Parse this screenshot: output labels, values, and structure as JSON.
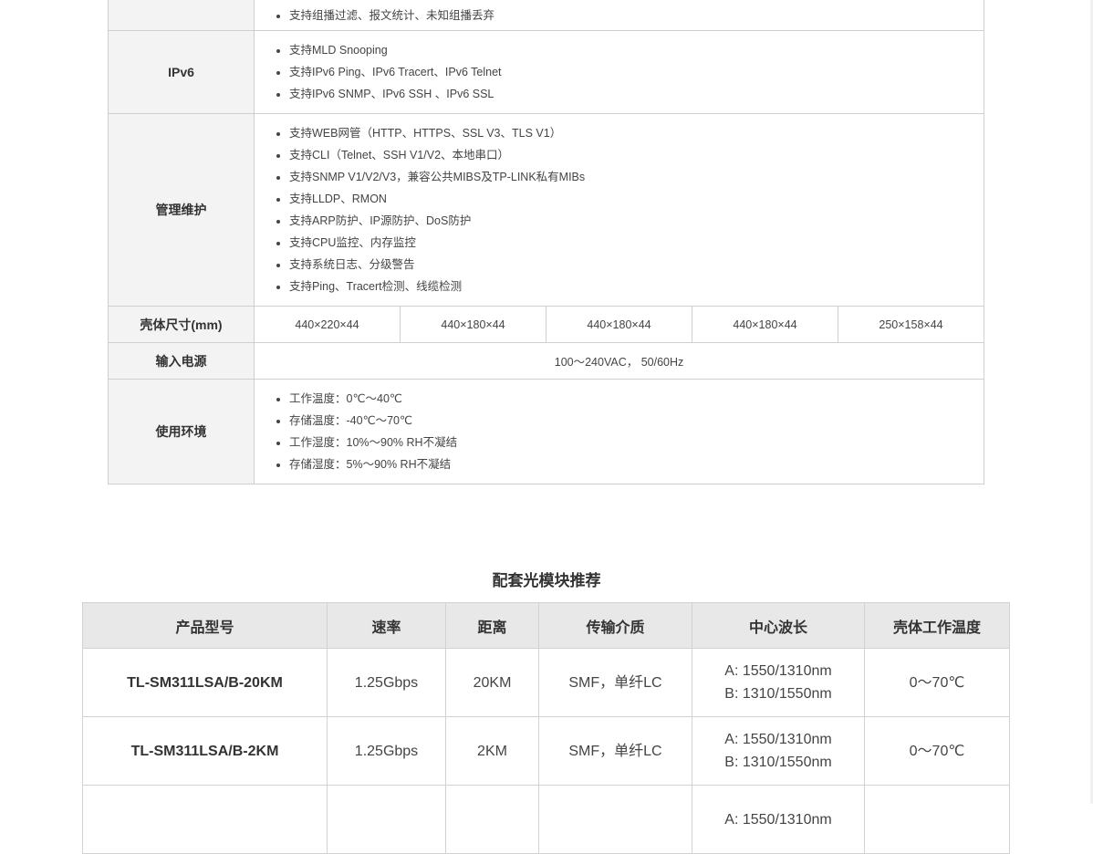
{
  "spec": {
    "multicast": {
      "items": [
        "支持组播过滤、报文统计、未知组播丢弃"
      ]
    },
    "ipv6": {
      "label": "IPv6",
      "items": [
        "支持MLD Snooping",
        "支持IPv6 Ping、IPv6 Tracert、IPv6 Telnet",
        "支持IPv6 SNMP、IPv6 SSH 、IPv6 SSL"
      ]
    },
    "management": {
      "label": "管理维护",
      "items": [
        "支持WEB网管（HTTP、HTTPS、SSL V3、TLS V1）",
        "支持CLI（Telnet、SSH V1/V2、本地串口）",
        "支持SNMP V1/V2/V3，兼容公共MIBS及TP-LINK私有MIBs",
        "支持LLDP、RMON",
        "支持ARP防护、IP源防护、DoS防护",
        "支持CPU监控、内存监控",
        "支持系统日志、分级警告",
        "支持Ping、Tracert检测、线缆检测"
      ]
    },
    "dimensions": {
      "label": "壳体尺寸(mm)",
      "values": [
        "440×220×44",
        "440×180×44",
        "440×180×44",
        "440×180×44",
        "250×158×44"
      ]
    },
    "power": {
      "label": "输入电源",
      "value": "100～240VAC， 50/60Hz"
    },
    "environment": {
      "label": "使用环境",
      "items": [
        "工作温度：0℃～40℃",
        "存储温度：-40℃～70℃",
        "工作湿度：10%～90% RH不凝结",
        "存储湿度：5%～90% RH不凝结"
      ]
    }
  },
  "optical": {
    "title": "配套光模块推荐",
    "headers": [
      "产品型号",
      "速率",
      "距离",
      "传输介质",
      "中心波长",
      "壳体工作温度"
    ],
    "rows": [
      {
        "model": "TL-SM311LSA/B-20KM",
        "rate": "1.25Gbps",
        "distance": "20KM",
        "medium": "SMF，单纤LC",
        "wl_a": "A: 1550/1310nm",
        "wl_b": "B: 1310/1550nm",
        "temp": "0～70℃"
      },
      {
        "model": "TL-SM311LSA/B-2KM",
        "rate": "1.25Gbps",
        "distance": "2KM",
        "medium": "SMF，单纤LC",
        "wl_a": "A: 1550/1310nm",
        "wl_b": "B: 1310/1550nm",
        "temp": "0～70℃"
      },
      {
        "model": "",
        "rate": "",
        "distance": "",
        "medium": "",
        "wl_a": "A: 1550/1310nm",
        "wl_b": "",
        "temp": ""
      }
    ]
  }
}
